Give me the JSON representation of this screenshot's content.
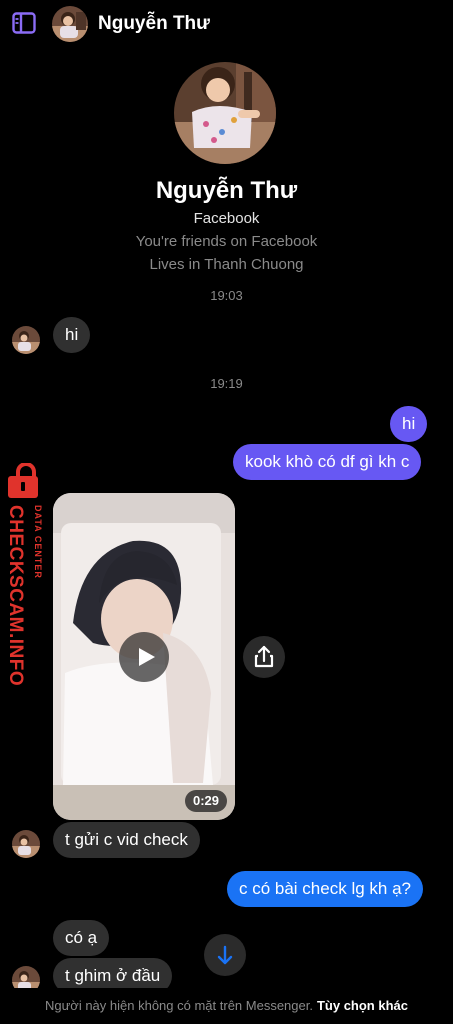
{
  "header": {
    "name": "Nguyễn Thư",
    "sidebar_icon": "sidebar-icon",
    "accent": "#8b6cf5"
  },
  "profile": {
    "name": "Nguyễn Thư",
    "source": "Facebook",
    "friends": "You're friends on Facebook",
    "lives": "Lives in Thanh Chuong"
  },
  "messages": {
    "time1": "19:03",
    "msg_hi_in": "hi",
    "time2": "19:19",
    "msg_hi_out": "hi",
    "msg_kook": "kook khò có df gì kh c",
    "video_duration": "0:29",
    "msg_vid": "t gửi c vid check",
    "msg_check": "c có bài check lg kh ạ?",
    "msg_coa": "có ạ",
    "msg_ghim": "t ghim ở đầu"
  },
  "watermark": {
    "main": "CHECKSCAM.INFO",
    "sub": "DATA CENTER",
    "color": "#e0332c"
  },
  "footer": {
    "text": "Người này hiện không có mặt trên Messenger.",
    "link": "Tùy chọn khác"
  },
  "colors": {
    "outgoing_purple": "#6758f3",
    "outgoing_blue": "#1a73f5",
    "incoming": "#303030"
  }
}
